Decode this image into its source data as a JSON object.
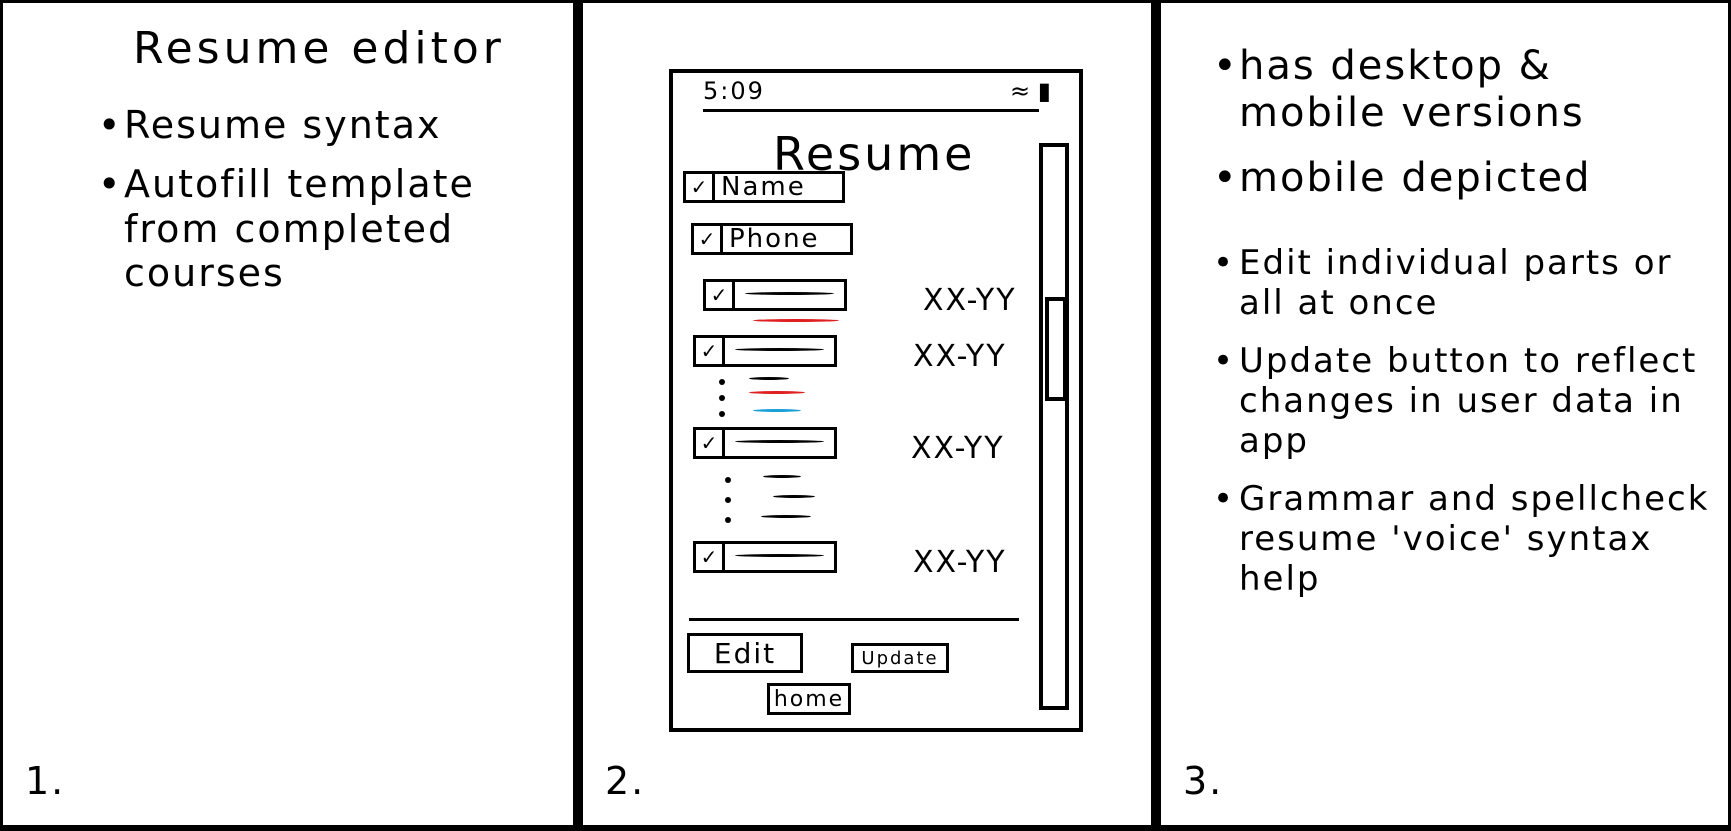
{
  "panel1": {
    "title": "Resume editor",
    "notes": [
      "Resume syntax",
      "Autofill template from completed courses"
    ],
    "number": "1."
  },
  "panel2": {
    "number": "2.",
    "phone": {
      "time": "5:09",
      "title": "Resume",
      "fields": [
        {
          "label": "Name",
          "check": "✓"
        },
        {
          "label": "Phone",
          "check": "✓"
        }
      ],
      "entries": [
        {
          "check": "✓",
          "range": "XX-YY"
        },
        {
          "check": "✓",
          "range": "XX-YY"
        },
        {
          "check": "✓",
          "range": "XX-YY"
        },
        {
          "check": "✓",
          "range": "XX-YY"
        }
      ],
      "buttons": {
        "edit": "Edit",
        "update": "Update",
        "home": "home"
      },
      "colors": {
        "spelling_error": "#e02020",
        "grammar_error": "#1aa0d8"
      }
    }
  },
  "panel3": {
    "number": "3.",
    "notes": [
      "has desktop & mobile versions",
      "mobile depicted",
      "Edit individual parts or all at once",
      "Update button to reflect changes in user data in app",
      "Grammar and spellcheck resume 'voice' syntax help"
    ]
  }
}
